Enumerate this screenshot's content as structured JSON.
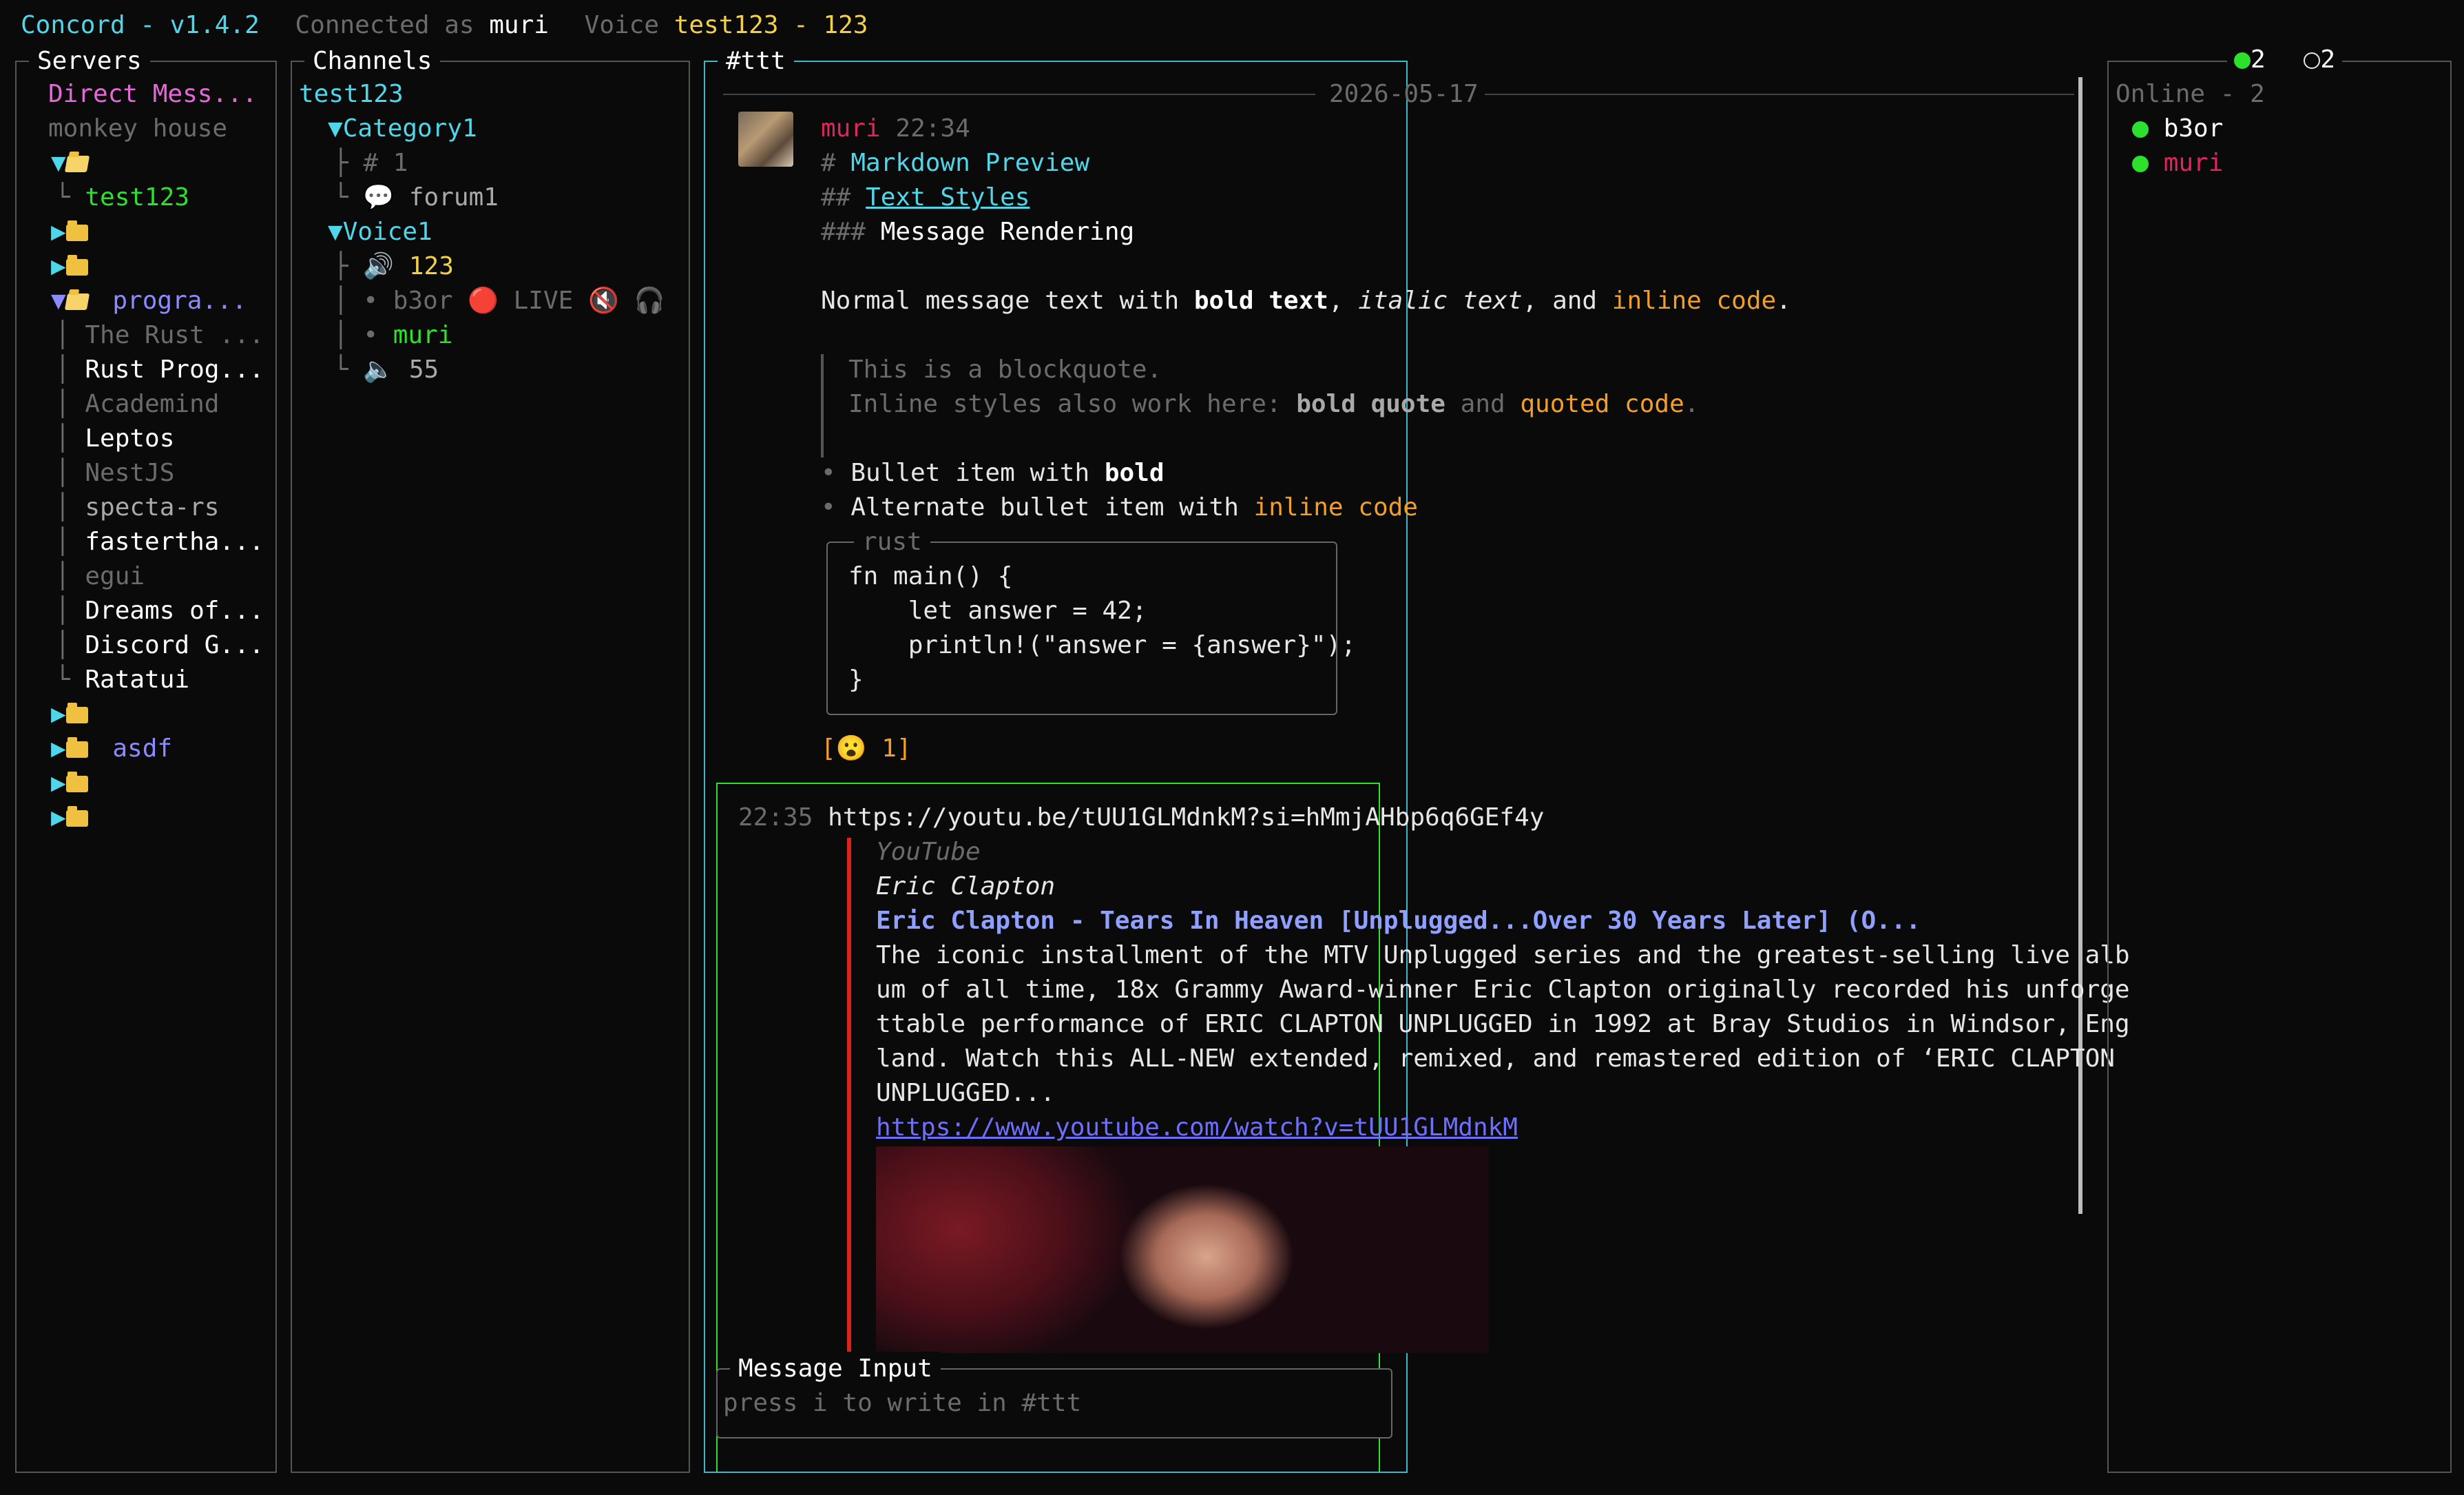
{
  "topbar": {
    "app": "Concord - v1.4.2",
    "connected_prefix": "Connected as",
    "user": "muri",
    "voice_prefix": "Voice",
    "voice_value": "test123 - 123"
  },
  "servers": {
    "title": "Servers",
    "direct_messages": "Direct Mess...",
    "monkey_house": "monkey house",
    "test123": "test123",
    "progra": "progra...",
    "rust1": "The Rust ...",
    "rust2": "Rust Prog...",
    "academind": "Academind",
    "leptos": "Leptos",
    "nestjs": "NestJS",
    "specta": "specta-rs",
    "fastertha": "fastertha...",
    "egui": "egui",
    "dreams": "Dreams of...",
    "discord": "Discord G...",
    "ratatui": "Ratatui",
    "asdf": "asdf"
  },
  "channels": {
    "title": "Channels",
    "server_name": "test123",
    "category1": "Category1",
    "ch1": "1",
    "forum1": "forum1",
    "voice1": "Voice1",
    "voice123": "123",
    "user_b3or": "b3or",
    "live": "LIVE",
    "user_muri": "muri",
    "voice55": "55"
  },
  "chat": {
    "title": "#ttt",
    "date": "2026-05-17",
    "msg1": {
      "author": "muri",
      "time": "22:34",
      "h1_mark": "#",
      "h1": "Markdown Preview",
      "h2_mark": "##",
      "h2": "Text Styles",
      "h3_mark": "###",
      "h3": "Message Rendering",
      "p_start": "Normal message text with ",
      "p_bold": "bold text",
      "p_sep1": ", ",
      "p_italic": "italic text",
      "p_sep2": ", and ",
      "p_code": "inline code",
      "p_end": ".",
      "quote1": "This is a blockquote.",
      "quote2_start": "Inline styles also work here: ",
      "quote2_bold": "bold quote",
      "quote2_and": " and ",
      "quote2_code": "quoted code",
      "quote2_end": ".",
      "bullet1_start": "Bullet item with ",
      "bullet1_bold": "bold",
      "bullet2_start": "Alternate bullet item with ",
      "bullet2_code": "inline code",
      "code_lang": "rust",
      "code_l1": "fn main() {",
      "code_l2": "    let answer = 42;",
      "code_l3": "    println!(\"answer = {answer}\");",
      "code_l4": "}",
      "reaction_open": "[",
      "reaction_count": " 1]"
    },
    "msg2": {
      "time": "22:35",
      "url": "https://youtu.be/tUU1GLMdnkM?si=hMmjAHbp6q6GEf4y",
      "embed_provider": "YouTube",
      "embed_author": "Eric Clapton",
      "embed_title": "Eric Clapton - Tears In Heaven [Unplugged...Over 30 Years Later] (O...",
      "embed_desc1": "The iconic installment of the MTV Unplugged series and the greatest-selling live alb",
      "embed_desc2": "um of all time, 18x Grammy Award-winner Eric Clapton originally recorded his unforge",
      "embed_desc3": "ttable performance of ERIC CLAPTON UNPLUGGED in 1992 at Bray Studios in Windsor, Eng",
      "embed_desc4": "land. Watch this ALL-NEW extended, remixed, and remastered edition of ‘ERIC CLAPTON",
      "embed_desc5": "UNPLUGGED...",
      "embed_link": "https://www.youtube.com/watch?v=tUU1GLMdnkM"
    },
    "input_title": "Message Input",
    "input_placeholder": "press i to write in #ttt"
  },
  "members": {
    "online_count": "2",
    "offline_count": "2",
    "online_title": "Online - 2",
    "m1": "b3or",
    "m2": "muri"
  },
  "colors": {
    "accent_cyan": "#4fd6e8",
    "selected_border": "#2ee02e",
    "user_red": "#e0245e",
    "code_orange": "#ef9f2a"
  }
}
